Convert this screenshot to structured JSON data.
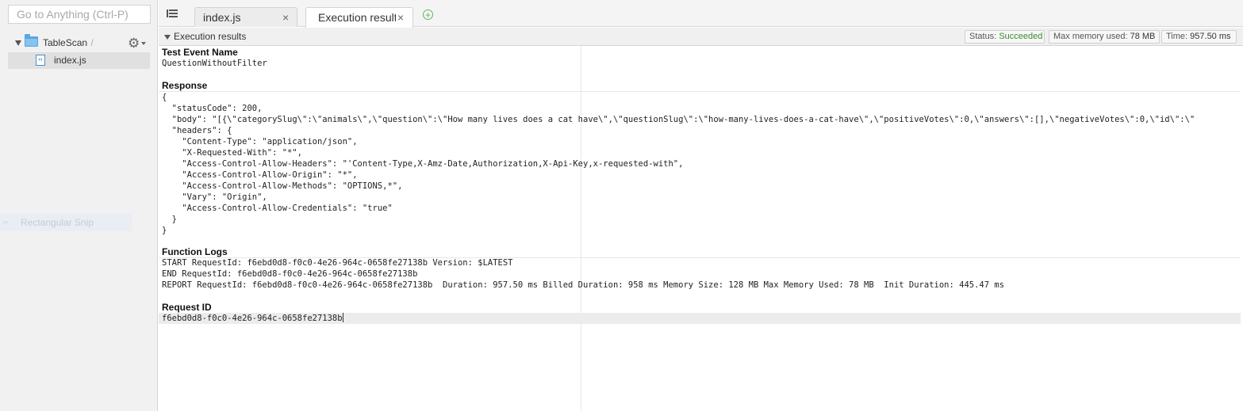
{
  "sidebar": {
    "goto_placeholder": "Go to Anything (Ctrl-P)",
    "tree": {
      "root_label": "TableScan",
      "root_suffix": "- /",
      "file_label": "index.js"
    },
    "snip_label": "Rectangular Snip"
  },
  "tabs": [
    {
      "label": "index.js",
      "close": "×"
    },
    {
      "label": "Execution results",
      "close": "×"
    }
  ],
  "add_tab": "+",
  "results": {
    "title": "Execution results",
    "status_label": "Status:",
    "status_value": "Succeeded",
    "memory_label": "Max memory used:",
    "memory_value": "78 MB",
    "time_label": "Time:",
    "time_value": "957.50 ms",
    "status_color": "#3a8a2a"
  },
  "sections": {
    "test_event": {
      "title": "Test Event Name",
      "value": "QuestionWithoutFilter"
    },
    "response": {
      "title": "Response",
      "lines": [
        "{",
        "  \"statusCode\": 200,",
        "  \"body\": \"[{\\\"categorySlug\\\":\\\"animals\\\",\\\"question\\\":\\\"How many lives does a cat have\\\",\\\"questionSlug\\\":\\\"how-many-lives-does-a-cat-have\\\",\\\"positiveVotes\\\":0,\\\"answers\\\":[],\\\"negativeVotes\\\":0,\\\"id\\\":\\\"",
        "  \"headers\": {",
        "    \"Content-Type\": \"application/json\",",
        "    \"X-Requested-With\": \"*\",",
        "    \"Access-Control-Allow-Headers\": \"'Content-Type,X-Amz-Date,Authorization,X-Api-Key,x-requested-with\",",
        "    \"Access-Control-Allow-Origin\": \"*\",",
        "    \"Access-Control-Allow-Methods\": \"OPTIONS,*\",",
        "    \"Vary\": \"Origin\",",
        "    \"Access-Control-Allow-Credentials\": \"true\"",
        "  }",
        "}"
      ]
    },
    "function_logs": {
      "title": "Function Logs",
      "lines": [
        "START RequestId: f6ebd0d8-f0c0-4e26-964c-0658fe27138b Version: $LATEST",
        "END RequestId: f6ebd0d8-f0c0-4e26-964c-0658fe27138b",
        "REPORT RequestId: f6ebd0d8-f0c0-4e26-964c-0658fe27138b  Duration: 957.50 ms Billed Duration: 958 ms Memory Size: 128 MB Max Memory Used: 78 MB  Init Duration: 445.47 ms"
      ]
    },
    "request_id": {
      "title": "Request ID",
      "value": "f6ebd0d8-f0c0-4e26-964c-0658fe27138b"
    }
  },
  "icons": {
    "folder": "folder-icon",
    "js_file": "js-file-icon",
    "gear": "gear-icon",
    "tab_list": "tab-list-icon",
    "add_tab": "add-tab-icon"
  }
}
